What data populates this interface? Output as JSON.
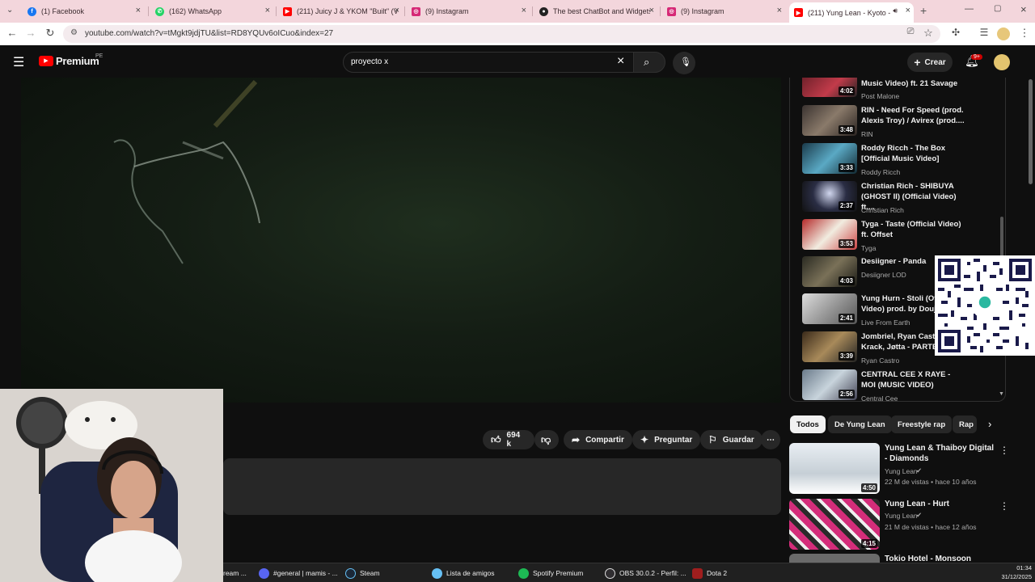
{
  "browser": {
    "tabs": [
      {
        "label": "(1) Facebook",
        "color": "#1877f2"
      },
      {
        "label": "(162) WhatsApp",
        "color": "#25d366"
      },
      {
        "label": "(211) Juicy J & YKOM \"Built\" (V",
        "color": "#ff0000"
      },
      {
        "label": "(9) Instagram",
        "color": "#d62976"
      },
      {
        "label": "The best ChatBot and Widgets",
        "color": "#222222"
      },
      {
        "label": "(9) Instagram",
        "color": "#d62976"
      },
      {
        "label": "(211) Yung Lean - Kyoto -",
        "color": "#ff0000"
      }
    ],
    "url": "youtube.com/watch?v=tMgkt9jdjTU&list=RD8YQUv6oICuo&index=27"
  },
  "youtube": {
    "logo": "Premium",
    "region": "PE",
    "search_value": "proyecto x",
    "create_label": "Crear",
    "notif_badge": "9+",
    "actions": {
      "likes": "694 k",
      "share": "Compartir",
      "ask": "Preguntar",
      "save": "Guardar"
    },
    "playlist": [
      {
        "title": "Music Video) ft. 21 Savage",
        "channel": "Post Malone",
        "duration": "4:02"
      },
      {
        "title": "RIN - Need For Speed (prod. Alexis Troy) / Avirex (prod....",
        "channel": "RIN",
        "duration": "3:48"
      },
      {
        "title": "Roddy Ricch - The Box [Official Music Video]",
        "channel": "Roddy Ricch",
        "duration": "3:33"
      },
      {
        "title": "Christian Rich - SHIBUYA (GHOST II) (Official Video) ft....",
        "channel": "Christian Rich",
        "duration": "2:37"
      },
      {
        "title": "Tyga - Taste (Official Video) ft. Offset",
        "channel": "Tyga",
        "duration": "3:53"
      },
      {
        "title": "Desiigner - Panda",
        "channel": "Desiigner LOD",
        "duration": "4:03"
      },
      {
        "title": "Yung Hurn - Stoli (Offi Video) prod. by Douji",
        "channel": "Live From Earth",
        "duration": "2:41"
      },
      {
        "title": "Jombriel, Ryan Castro Krack, Jøtta - PARTE Y",
        "channel": "Ryan Castro",
        "duration": "3:39"
      },
      {
        "title": "CENTRAL CEE X RAYE - MOI (MUSIC VIDEO)",
        "channel": "Central Cee",
        "duration": "2:56"
      }
    ],
    "chips": [
      "Todos",
      "De Yung Lean",
      "Freestyle rap",
      "Rap"
    ],
    "recs": [
      {
        "title": "Yung Lean & Thaiboy Digital - Diamonds",
        "channel": "Yung Lean",
        "meta": "22 M de vistas • hace 10 años",
        "duration": "4:50"
      },
      {
        "title": "Yung Lean - Hurt",
        "channel": "Yung Lean",
        "meta": "21 M de vistas • hace 12 años",
        "duration": "4:15"
      },
      {
        "title": "Tokio Hotel - Monsoon",
        "channel": "",
        "meta": "",
        "duration": ""
      }
    ]
  },
  "taskbar": {
    "items": [
      {
        "label": "ream ...",
        "color": "#555555"
      },
      {
        "label": "#general | mamis - ...",
        "color": "#5865f2"
      },
      {
        "label": "Steam",
        "color": "#1b2838"
      },
      {
        "label": "Lista de amigos",
        "color": "#66c0f4"
      },
      {
        "label": "Spotify Premium",
        "color": "#1db954"
      },
      {
        "label": "OBS 30.0.2 - Perfil: ...",
        "color": "#302e31"
      },
      {
        "label": "Dota 2",
        "color": "#a01e1e"
      }
    ],
    "time": "01:34",
    "date": "31/12/2025"
  }
}
